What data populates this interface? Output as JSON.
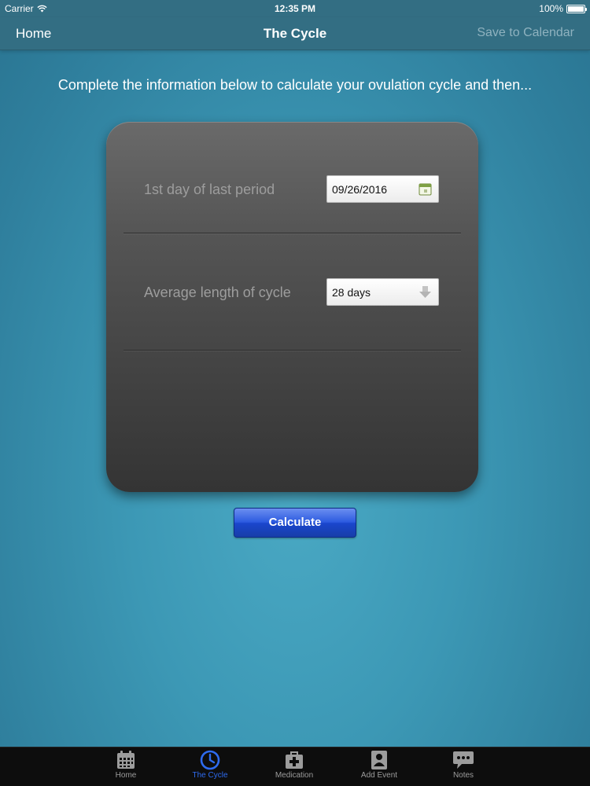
{
  "status_bar": {
    "carrier": "Carrier",
    "time": "12:35 PM",
    "battery": "100%"
  },
  "nav": {
    "back_label": "Home",
    "title": "The Cycle",
    "action_label": "Save to Calendar"
  },
  "intro_text": "Complete the information below to calculate your ovulation cycle and then...",
  "form": {
    "period_label": "1st day of last period",
    "period_value": "09/26/2016",
    "cycle_label": "Average length of cycle",
    "cycle_value": "28 days"
  },
  "calculate_label": "Calculate",
  "tabs": [
    {
      "label": "Home",
      "icon": "calendar-icon",
      "active": false
    },
    {
      "label": "The Cycle",
      "icon": "clock-icon",
      "active": true
    },
    {
      "label": "Medication",
      "icon": "medical-bag-icon",
      "active": false
    },
    {
      "label": "Add Event",
      "icon": "person-badge-icon",
      "active": false
    },
    {
      "label": "Notes",
      "icon": "speech-bubble-icon",
      "active": false
    }
  ],
  "colors": {
    "tab_active": "#2e6bef",
    "nav_bar": "#336e83",
    "button": "#2c5ae0"
  }
}
